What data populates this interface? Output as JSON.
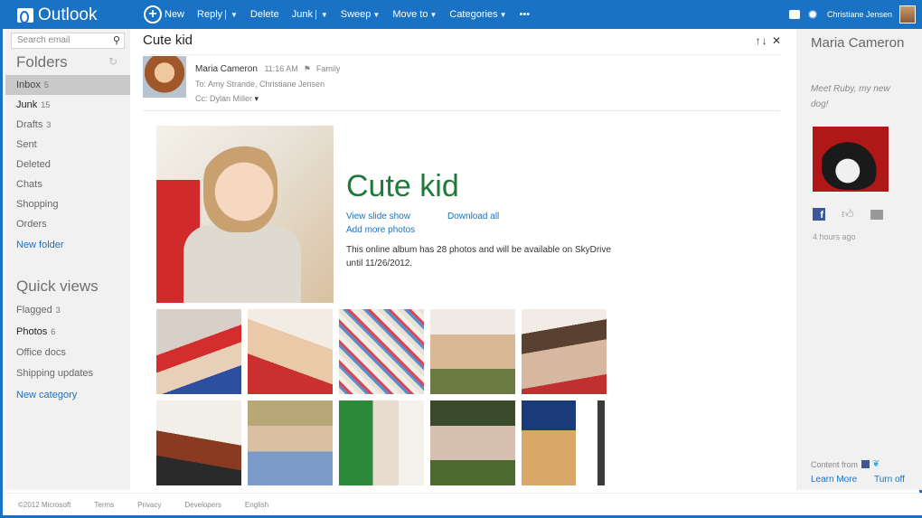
{
  "app": {
    "title": "Outlook"
  },
  "toolbar": {
    "new_label": "New",
    "reply_label": "Reply",
    "delete_label": "Delete",
    "junk_label": "Junk",
    "sweep_label": "Sweep",
    "moveto_label": "Move to",
    "categories_label": "Categories",
    "more_label": "•••"
  },
  "account": {
    "user_name": "Christiane Jensen"
  },
  "search": {
    "placeholder": "Search email"
  },
  "folders": {
    "title": "Folders",
    "items": [
      {
        "label": "Inbox",
        "count": "5"
      },
      {
        "label": "Junk",
        "count": "15"
      },
      {
        "label": "Drafts",
        "count": "3"
      },
      {
        "label": "Sent",
        "count": ""
      },
      {
        "label": "Deleted",
        "count": ""
      },
      {
        "label": "Chats",
        "count": ""
      },
      {
        "label": "Shopping",
        "count": ""
      },
      {
        "label": "Orders",
        "count": ""
      }
    ],
    "new_folder_label": "New folder"
  },
  "quick_views": {
    "title": "Quick views",
    "items": [
      {
        "label": "Flagged",
        "count": "3"
      },
      {
        "label": "Photos",
        "count": "6"
      },
      {
        "label": "Office docs",
        "count": ""
      },
      {
        "label": "Shipping updates",
        "count": ""
      }
    ],
    "new_category_label": "New category"
  },
  "message": {
    "subject": "Cute kid",
    "nav_icons": "↑↓✕",
    "from": "Maria Cameron",
    "time": "11:16 AM",
    "category": "Family",
    "to": "To: Amy Strande, Christiane Jensen",
    "cc": "Cc: Dylan Miller"
  },
  "album": {
    "title": "Cute kid",
    "view_slideshow": "View slide show",
    "download_all": "Download all",
    "add_more": "Add more photos",
    "description": "This online album has 28 photos and will be available on SkyDrive until 11/26/2012."
  },
  "people_pane": {
    "name": "Maria Cameron",
    "status": "Meet Ruby, my new dog!",
    "time": "4 hours ago",
    "content_from": "Content from",
    "learn_more": "Learn More",
    "turn_off": "Turn off"
  },
  "footer": {
    "copyright": "©2012 Microsoft",
    "terms": "Terms",
    "privacy": "Privacy",
    "developers": "Developers",
    "language": "English"
  }
}
